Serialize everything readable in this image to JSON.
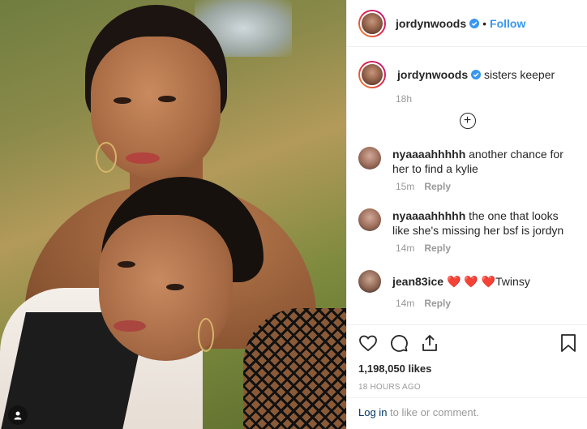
{
  "post": {
    "username": "jordynwoods",
    "follow_label": "Follow",
    "dot": "•",
    "caption": "sisters keeper",
    "caption_time": "18h"
  },
  "comments": [
    {
      "user": "nyaaaahhhhh",
      "text": "another chance for her to find a kylie",
      "time": "15m",
      "reply": "Reply"
    },
    {
      "user": "nyaaaahhhhh",
      "text": "the one that looks like she's missing her bsf is jordyn",
      "time": "14m",
      "reply": "Reply"
    },
    {
      "user": "jean83ice",
      "text": "❤️ ❤️ ❤️Twinsy",
      "time": "14m",
      "reply": "Reply"
    }
  ],
  "engagement": {
    "likes": "1,198,050 likes",
    "posted": "18 HOURS AGO"
  },
  "login": {
    "link": "Log in",
    "rest": " to like or comment."
  },
  "colors": {
    "accent": "#3897f0",
    "text": "#262626",
    "muted": "#999999",
    "link": "#003569"
  },
  "icons": [
    "verified-badge-icon",
    "add-comment-icon",
    "heart-icon",
    "comment-icon",
    "share-icon",
    "bookmark-icon",
    "tag-people-icon"
  ]
}
